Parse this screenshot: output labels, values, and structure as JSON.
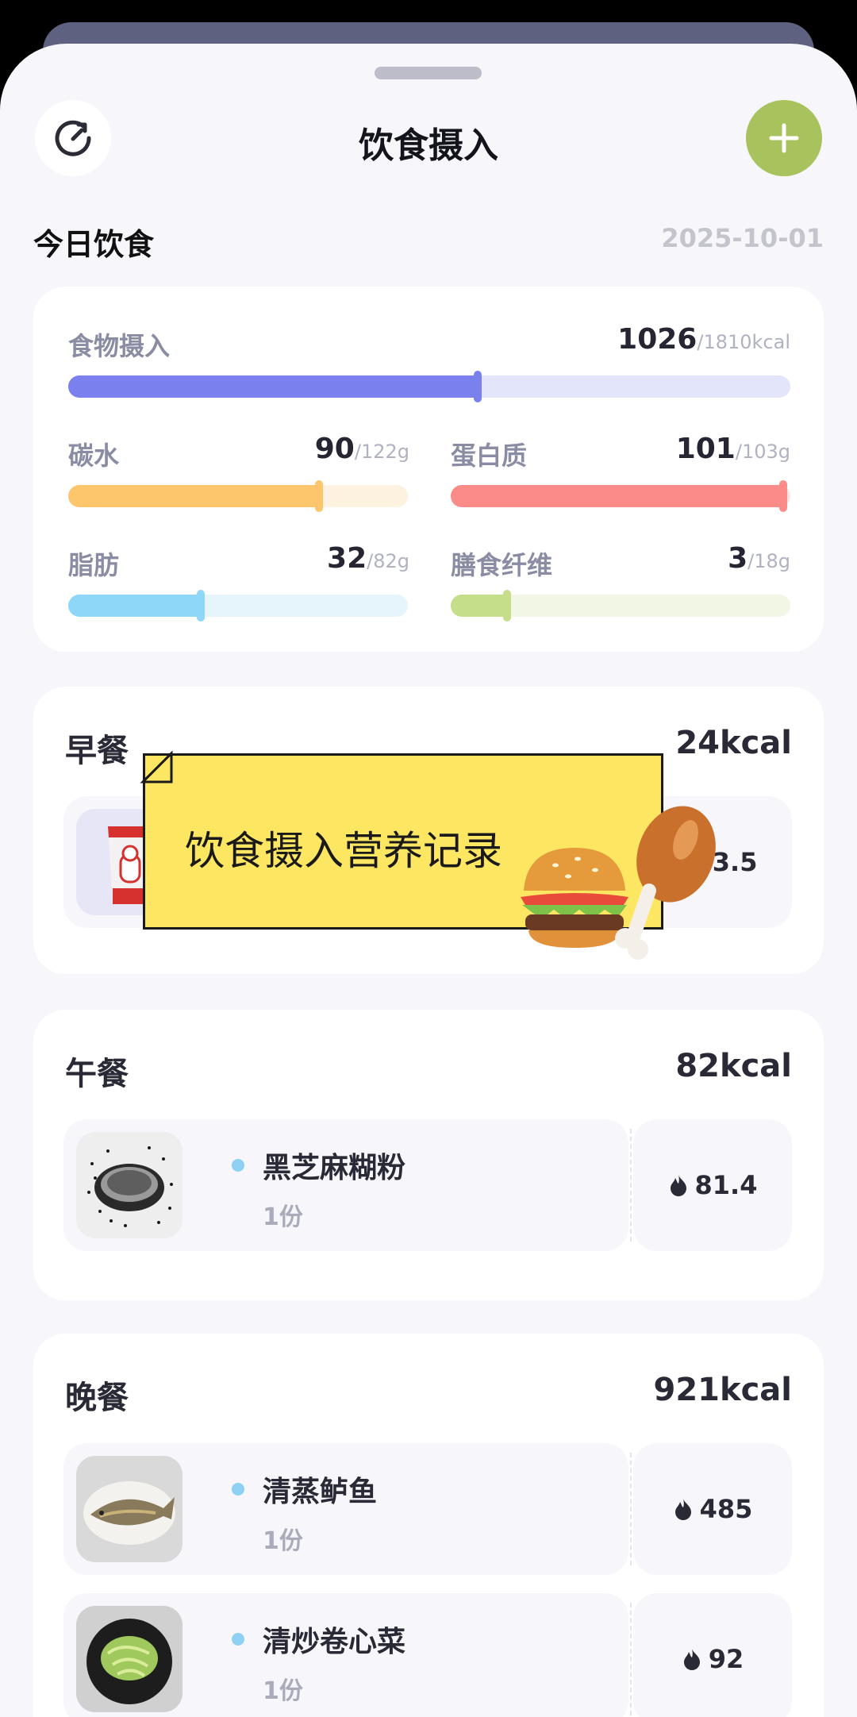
{
  "header": {
    "title": "饮食摄入"
  },
  "today": {
    "title": "今日饮食",
    "date": "2025-10-01"
  },
  "summary": {
    "food": {
      "label": "食物摄入",
      "value": "1026",
      "target": "/1810kcal",
      "fraction": 0.567,
      "color": "#7b80ef",
      "track": "#e3e5fb"
    },
    "carbs": {
      "label": "碳水",
      "value": "90",
      "target": "/122g",
      "fraction": 0.738,
      "color": "#fdc66d",
      "track": "#fdf1df"
    },
    "protein": {
      "label": "蛋白质",
      "value": "101",
      "target": "/103g",
      "fraction": 0.98,
      "color": "#fb8b89",
      "track": "#fde4e3"
    },
    "fat": {
      "label": "脂肪",
      "value": "32",
      "target": "/82g",
      "fraction": 0.39,
      "color": "#8fd7f8",
      "track": "#e6f5fc"
    },
    "fiber": {
      "label": "膳食纤维",
      "value": "3",
      "target": "/18g",
      "fraction": 0.167,
      "color": "#c5de8a",
      "track": "#f1f6e5"
    }
  },
  "meals": {
    "breakfast": {
      "title": "早餐",
      "kcal": "24kcal",
      "items": [
        {
          "kcal": "23.5"
        }
      ]
    },
    "lunch": {
      "title": "午餐",
      "kcal": "82kcal",
      "items": [
        {
          "name": "黑芝麻糊粉",
          "qty": "1份",
          "kcal": "81.4"
        }
      ]
    },
    "dinner": {
      "title": "晚餐",
      "kcal": "921kcal",
      "items": [
        {
          "name": "清蒸鲈鱼",
          "qty": "1份",
          "kcal": "485"
        },
        {
          "name": "清炒卷心菜",
          "qty": "1份",
          "kcal": "92"
        }
      ]
    }
  },
  "overlay": {
    "caption": "饮食摄入营养记录"
  },
  "icons": {
    "refresh": "refresh-icon",
    "add": "plus-icon",
    "flame": "flame-icon",
    "burger": "burger-icon",
    "drumstick": "drumstick-icon"
  }
}
